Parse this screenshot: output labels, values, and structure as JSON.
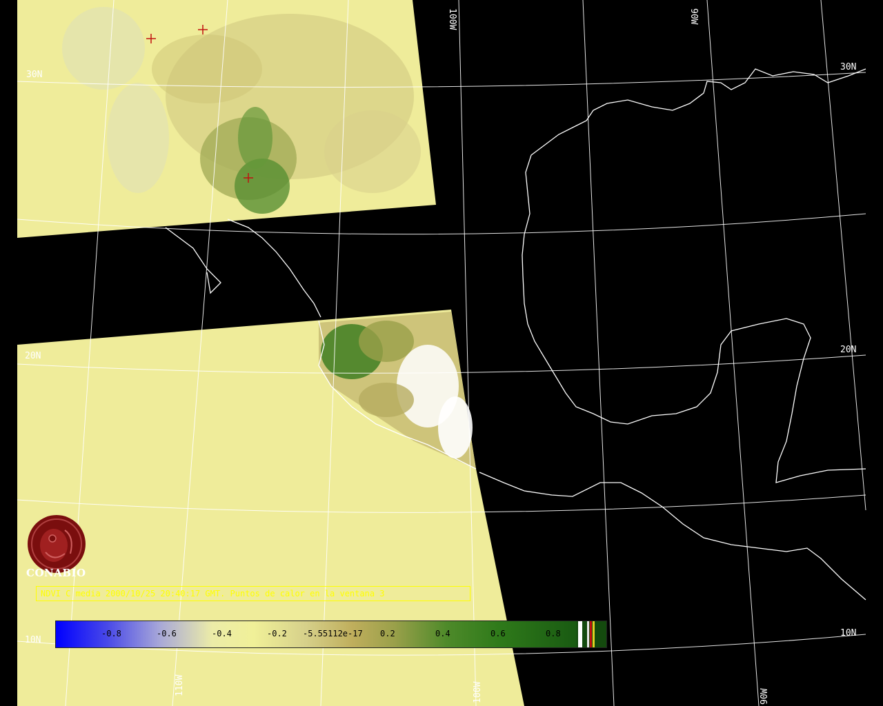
{
  "map": {
    "grid_labels": {
      "lat_30n_left": "30N",
      "lat_30n_right": "30N",
      "lat_20n_left": "20N",
      "lat_20n_right": "20N",
      "lat_10n_left": "10N",
      "lat_10n_right": "10N",
      "lon_100w_top": "100W",
      "lon_90w_top": "90W",
      "lon_110w_bottom": "110W",
      "lon_100w_bottom": "100W",
      "lon_90w_bottom": "90W"
    },
    "colors": {
      "background": "#000000",
      "swath_fill": "#f0ee9a",
      "grid_line": "#ffffff",
      "coastline": "#ffffff",
      "marker": "#c01010",
      "vegetation_dark": "#2f7a1a",
      "vegetation_mid": "#9a9a4a"
    },
    "markers_count_label": ""
  },
  "logo": {
    "name": "CONABIO",
    "color": "#7a0e0e"
  },
  "caption": {
    "text": "NDVI C media 2000/10/25 20:40:17 GMT. Puntos de calor en la ventana 3"
  },
  "colorbar": {
    "ticks": [
      "-0.8",
      "-0.6",
      "-0.4",
      "-0.2",
      "-5.55112e-17",
      "0.2",
      "0.4",
      "0.6",
      "0.8"
    ]
  }
}
